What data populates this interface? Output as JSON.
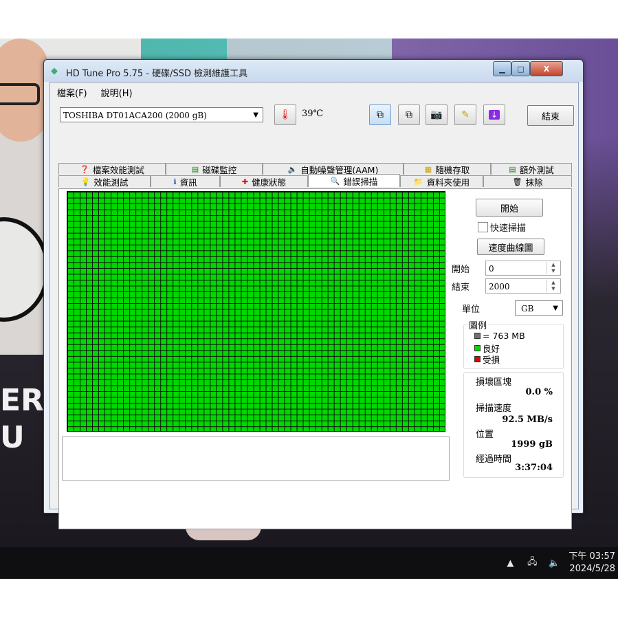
{
  "window": {
    "title": "HD Tune Pro 5.75 - 硬碟/SSD 檢測維護工具",
    "min_label": "▁",
    "max_label": "□",
    "close_label": "X"
  },
  "menu": {
    "file": "檔案(F)",
    "help": "說明(H)"
  },
  "toolbar": {
    "drive": "TOSHIBA DT01ACA200 (2000 gB)",
    "temperature": "39℃",
    "exit_label": "結束"
  },
  "tabs_top": [
    {
      "label": "檔案效能測試",
      "icon": "file-benchmark-icon"
    },
    {
      "label": "磁碟監控",
      "icon": "disk-monitor-icon"
    },
    {
      "label": "自動噪聲管理(AAM)",
      "icon": "speaker-icon"
    },
    {
      "label": "隨機存取",
      "icon": "random-access-icon"
    },
    {
      "label": "額外測試",
      "icon": "extra-tests-icon"
    }
  ],
  "tabs_bottom": [
    {
      "label": "效能測試",
      "icon": "benchmark-icon"
    },
    {
      "label": "資訊",
      "icon": "info-icon"
    },
    {
      "label": "健康狀態",
      "icon": "health-cross-icon"
    },
    {
      "label": "錯誤掃描",
      "icon": "magnifier-icon",
      "active": true
    },
    {
      "label": "資料夾使用",
      "icon": "folder-icon"
    },
    {
      "label": "抹除",
      "icon": "trash-icon"
    }
  ],
  "scan": {
    "start_button": "開始",
    "quick_scan_label": "快速掃描",
    "quick_scan_checked": false,
    "speed_map_button": "速度曲線圖",
    "start_label": "開始",
    "start_value": "0",
    "end_label": "結束",
    "end_value": "2000",
    "unit_label": "單位",
    "unit_value": "GB",
    "legend_title": "圖例",
    "legend": [
      {
        "label": "= 763 MB",
        "color": "#707070"
      },
      {
        "label": "良好",
        "color": "#00d800"
      },
      {
        "label": "受損",
        "color": "#e00000"
      }
    ],
    "block_status": "all-good",
    "grid_columns": 61,
    "grid_rows": 41,
    "damaged_blocks_label": "損壞區塊",
    "damaged_blocks_value": "0.0 %",
    "scan_speed_label": "掃描速度",
    "scan_speed_value": "92.5 MB/s",
    "position_label": "位置",
    "position_value": "1999 gB",
    "elapsed_label": "經過時間",
    "elapsed_value": "3:37:04"
  },
  "taskbar": {
    "time": "下午 03:57",
    "date": "2024/5/28"
  },
  "desktop": {
    "poster_text_1": "ER",
    "poster_text_2": "U"
  }
}
